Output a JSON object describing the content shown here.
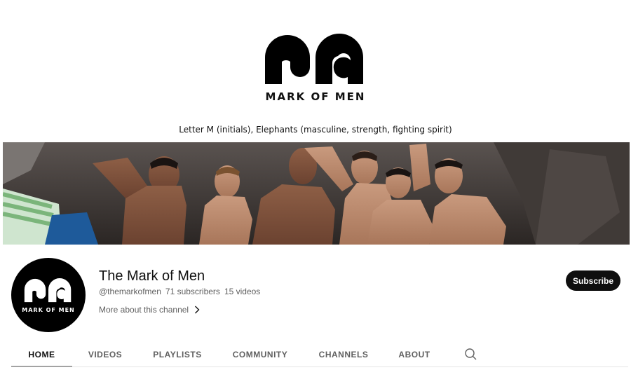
{
  "logo": {
    "brand_text": "MARK OF MEN",
    "icon": "mark-of-men-logo"
  },
  "caption": "Letter M (initials), Elephants (masculine, strength, fighting spirit)",
  "banner": {
    "description_icon": "group-photo-banner"
  },
  "channel": {
    "name": "The Mark of Men",
    "handle": "@themarkofmen",
    "subscribers": "71 subscribers",
    "videos": "15 videos",
    "more_about": "More about this channel",
    "avatar_text": "MARK OF MEN"
  },
  "subscribe_label": "Subscribe",
  "tabs": [
    {
      "label": "HOME",
      "active": true
    },
    {
      "label": "VIDEOS",
      "active": false
    },
    {
      "label": "PLAYLISTS",
      "active": false
    },
    {
      "label": "COMMUNITY",
      "active": false
    },
    {
      "label": "CHANNELS",
      "active": false
    },
    {
      "label": "ABOUT",
      "active": false
    }
  ],
  "colors": {
    "text": "#0f0f0f",
    "secondary": "#606060",
    "button": "#0f0f0f"
  }
}
